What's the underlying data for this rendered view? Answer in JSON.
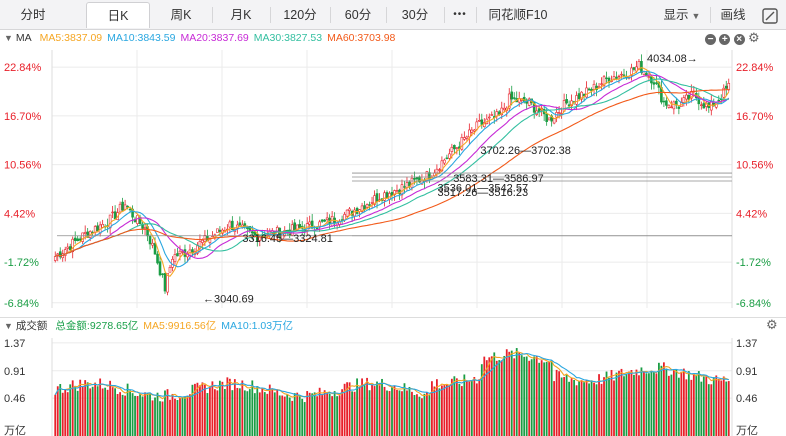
{
  "toolbar": {
    "buttons": [
      {
        "label": "分时",
        "active": false
      },
      {
        "label": "日K",
        "active": true
      },
      {
        "label": "周K",
        "active": false
      },
      {
        "label": "月K",
        "active": false
      },
      {
        "label": "120分",
        "active": false
      },
      {
        "label": "60分",
        "active": false
      },
      {
        "label": "30分",
        "active": false
      }
    ],
    "more_label": "•••",
    "f10_label": "同花顺F10",
    "display_label": "显示",
    "draw_label": "画线"
  },
  "price_legend": {
    "name": "MA",
    "items": [
      {
        "text": "MA5:3837.09",
        "color": "#f5a623"
      },
      {
        "text": "MA10:3843.59",
        "color": "#2aa7e0"
      },
      {
        "text": "MA20:3837.69",
        "color": "#c72bd6"
      },
      {
        "text": "MA30:3827.53",
        "color": "#33bfa0"
      },
      {
        "text": "MA60:3703.98",
        "color": "#f25a1a"
      }
    ]
  },
  "volume_legend": {
    "name": "成交额",
    "items": [
      {
        "text": "总金额:9278.65亿",
        "color": "#1aa04a"
      },
      {
        "text": "MA5:9916.56亿",
        "color": "#f5a623"
      },
      {
        "text": "MA10:1.03万亿",
        "color": "#2aa7e0"
      }
    ]
  },
  "colors": {
    "up": "#e8202a",
    "down": "#1a9d44",
    "grid": "#ebebeb",
    "level": "#8c8c8c"
  },
  "chart_data": [
    {
      "type": "candlestick",
      "y_axis_ticks": [
        "22.84%",
        "16.70%",
        "10.56%",
        "4.42%",
        "-1.72%",
        "-6.84%"
      ],
      "y_axis_values": [
        22.84,
        16.7,
        10.56,
        4.42,
        -1.72,
        -6.84
      ],
      "ylim": [
        -7.5,
        25.0
      ],
      "annotations": [
        {
          "text": "4034.08",
          "suffix": "→",
          "x_fraction": 0.875,
          "y": 23.5
        },
        {
          "text": "←3040.69",
          "x_fraction": 0.222,
          "y": -6.8
        },
        {
          "text": "3316.45—3324.81",
          "x_fraction": 0.28,
          "y": 0.8
        },
        {
          "text": "3702.26—3702.38",
          "x_fraction": 0.63,
          "y": 11.9
        },
        {
          "text": "3583.31—3586.97",
          "x_fraction": 0.59,
          "y": 8.4
        },
        {
          "text": "3536.01—3542.57",
          "x_fraction": 0.567,
          "y": 7.2
        },
        {
          "text": "3517.26—3516.23",
          "x_fraction": 0.567,
          "y": 6.6
        }
      ],
      "levels": [
        1.6,
        8.5,
        9.0,
        9.5
      ],
      "grid": true
    },
    {
      "type": "bar",
      "title": "成交额",
      "y_axis_ticks": [
        "1.37",
        "0.91",
        "0.46"
      ],
      "y_axis_values": [
        1.37,
        0.91,
        0.46
      ],
      "unit_label": "万亿",
      "ylim": [
        0,
        1.45
      ]
    }
  ]
}
